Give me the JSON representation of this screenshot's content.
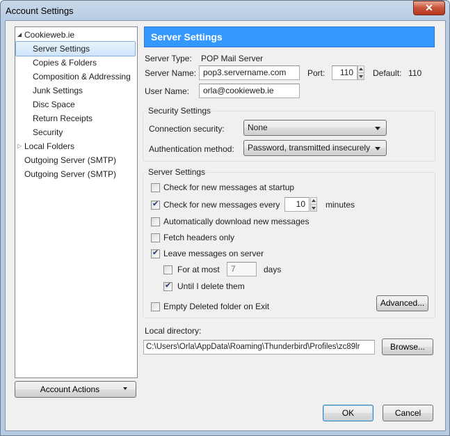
{
  "window": {
    "title": "Account Settings",
    "close_symbol": "✕"
  },
  "tree": {
    "account": "Cookieweb.ie",
    "items": [
      "Server Settings",
      "Copies & Folders",
      "Composition & Addressing",
      "Junk Settings",
      "Disc Space",
      "Return Receipts",
      "Security"
    ],
    "local_folders": "Local Folders",
    "outgoing_1": "Outgoing Server (SMTP)",
    "outgoing_2": "Outgoing Server (SMTP)"
  },
  "account_actions": "Account Actions",
  "panel": {
    "title": "Server Settings",
    "server_type_label": "Server Type:",
    "server_type_value": "POP Mail Server",
    "server_name_label": "Server Name:",
    "server_name_value": "pop3.servername.com",
    "port_label": "Port:",
    "port_value": "110",
    "default_label": "Default:",
    "default_value": "110",
    "user_name_label": "User Name:",
    "user_name_value": "orla@cookieweb.ie"
  },
  "security": {
    "group_title": "Security Settings",
    "connection_label": "Connection security:",
    "connection_value": "None",
    "auth_label": "Authentication method:",
    "auth_value": "Password, transmitted insecurely"
  },
  "server": {
    "group_title": "Server Settings",
    "check_startup": {
      "label": "Check for new messages at startup",
      "checked": false
    },
    "check_every": {
      "label": "Check for new messages every",
      "checked": true,
      "value": "10",
      "unit": "minutes"
    },
    "auto_download": {
      "label": "Automatically download new messages",
      "checked": false
    },
    "fetch_headers": {
      "label": "Fetch headers only",
      "checked": false
    },
    "leave_messages": {
      "label": "Leave messages on server",
      "checked": true
    },
    "for_at_most": {
      "label": "For at most",
      "checked": false,
      "value": "7",
      "unit": "days"
    },
    "until_delete": {
      "label": "Until I delete them",
      "checked": true
    },
    "empty_deleted": {
      "label": "Empty Deleted folder on Exit",
      "checked": false
    },
    "advanced_button": "Advanced..."
  },
  "local": {
    "label": "Local directory:",
    "path": "C:\\Users\\Orla\\AppData\\Roaming\\Thunderbird\\Profiles\\zc89lr",
    "browse_button": "Browse..."
  },
  "buttons": {
    "ok": "OK",
    "cancel": "Cancel"
  }
}
